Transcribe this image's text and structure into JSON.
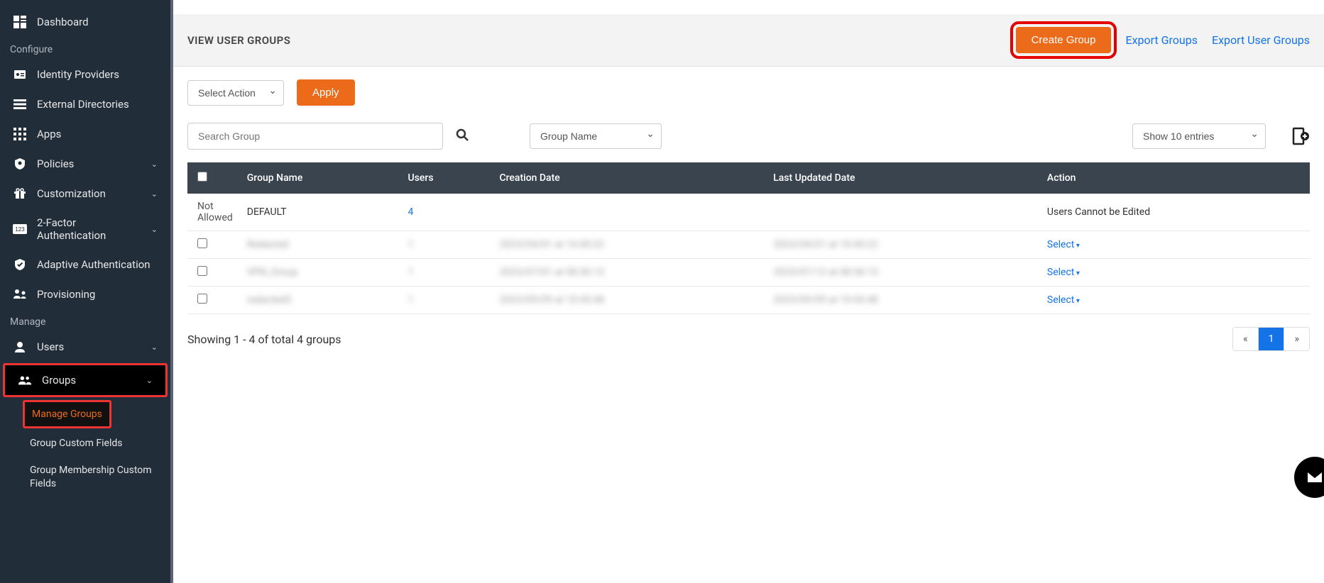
{
  "sidebar": {
    "items": [
      {
        "icon": "dashboard-icon",
        "label": "Dashboard",
        "chevron": false
      }
    ],
    "configure_heading": "Configure",
    "configure_items": [
      {
        "icon": "id-icon",
        "label": "Identity Providers",
        "chevron": false
      },
      {
        "icon": "list-icon",
        "label": "External Directories",
        "chevron": false
      },
      {
        "icon": "apps-icon",
        "label": "Apps",
        "chevron": false
      },
      {
        "icon": "shield-icon",
        "label": "Policies",
        "chevron": true
      },
      {
        "icon": "gift-icon",
        "label": "Customization",
        "chevron": true
      },
      {
        "icon": "123-icon",
        "label": "2-Factor Authentication",
        "chevron": true
      },
      {
        "icon": "check-shield-icon",
        "label": "Adaptive Authentication",
        "chevron": false
      },
      {
        "icon": "provisioning-icon",
        "label": "Provisioning",
        "chevron": false
      }
    ],
    "manage_heading": "Manage",
    "manage_items": [
      {
        "icon": "user-icon",
        "label": "Users",
        "chevron": true,
        "highlight": false
      },
      {
        "icon": "group-icon",
        "label": "Groups",
        "chevron": true,
        "highlight": true
      }
    ],
    "group_sub": [
      {
        "label": "Manage Groups",
        "active": true,
        "highlight": true
      },
      {
        "label": "Group Custom Fields",
        "active": false,
        "highlight": false
      },
      {
        "label": "Group Membership Custom Fields",
        "active": false,
        "highlight": false
      }
    ]
  },
  "header": {
    "title": "VIEW USER GROUPS",
    "create_button": "Create Group",
    "export_groups": "Export Groups",
    "export_user_groups": "Export User Groups"
  },
  "toolbar": {
    "select_action": "Select Action",
    "apply": "Apply"
  },
  "filters": {
    "search_placeholder": "Search Group",
    "filter_by": "Group Name",
    "show_entries": "Show 10 entries"
  },
  "table": {
    "columns": [
      "",
      "Group Name",
      "Users",
      "Creation Date",
      "Last Updated Date",
      "Action"
    ],
    "rows": [
      {
        "checkbox_text": "Not Allowed",
        "group": "DEFAULT",
        "users": "4",
        "users_link": true,
        "created": "",
        "updated": "",
        "action_text": "Users Cannot be Edited",
        "action_select": false,
        "blur": false
      },
      {
        "checkbox_text": "",
        "group": "Redacted",
        "users": "1",
        "users_link": false,
        "created": "2023/04/01 at 10:40:22",
        "updated": "2023/04/01 at 10:40:22",
        "action_text": "Select",
        "action_select": true,
        "blur": true
      },
      {
        "checkbox_text": "",
        "group": "VPN_Group",
        "users": "1",
        "users_link": false,
        "created": "2023/07/01 at 08:36:13",
        "updated": "2023/07/12 at 08:36:13",
        "action_text": "Select",
        "action_select": true,
        "blur": true
      },
      {
        "checkbox_text": "",
        "group": "redacted2",
        "users": "1",
        "users_link": false,
        "created": "2023/09/09 at 10:43:48",
        "updated": "2023/09/09 at 10:43:48",
        "action_text": "Select",
        "action_select": true,
        "blur": true
      }
    ]
  },
  "footer": {
    "showing": "Showing 1 - 4 of total 4 groups",
    "pages": {
      "prev": "«",
      "current": "1",
      "next": "»"
    }
  }
}
